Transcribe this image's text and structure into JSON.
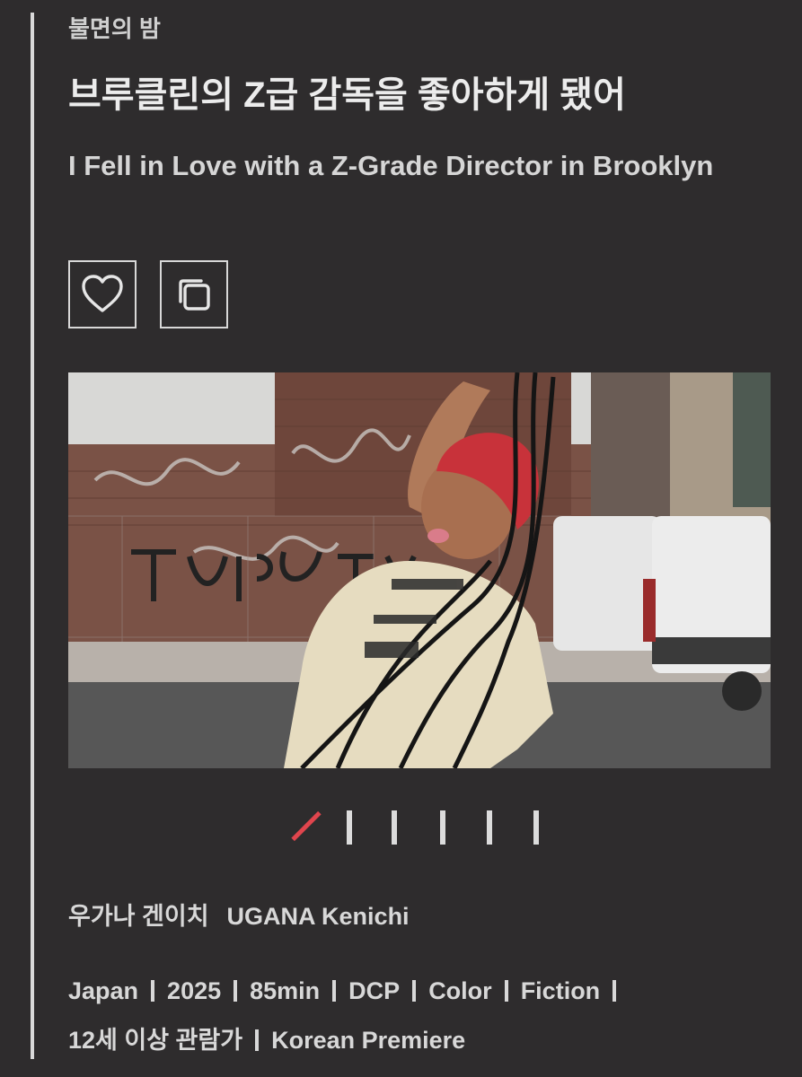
{
  "section_label": "불면의 밤",
  "title_ko": "브루클린의 Z급 감독을 좋아하게 됐어",
  "title_en": "I Fell in Love with a Z-Grade Director in Brooklyn",
  "actions": {
    "like_icon": "heart-icon",
    "copy_icon": "copy-icon"
  },
  "photo": {
    "description_icon": "film-still-image"
  },
  "pager": {
    "total": 6,
    "active_index": 0,
    "active_color": "#e0454d"
  },
  "director": {
    "name_ko": "우가나 겐이치",
    "name_en": "UGANA Kenichi"
  },
  "meta": {
    "country": "Japan",
    "year": "2025",
    "runtime": "85min",
    "format": "DCP",
    "color": "Color",
    "genre": "Fiction",
    "rating": "12세 이상 관람가",
    "premiere": "Korean Premiere"
  }
}
